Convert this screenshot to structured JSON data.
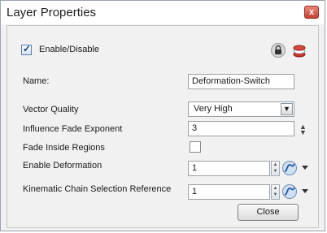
{
  "window": {
    "title": "Layer Properties",
    "close_glyph": "x"
  },
  "enable": {
    "label": "Enable/Disable",
    "checked": true
  },
  "icons": [
    "lock-icon",
    "layer-icon",
    "function-curve-icon",
    "chevron-down-icon"
  ],
  "fields": {
    "name": {
      "label": "Name:",
      "value": "Deformation-Switch"
    },
    "vector_quality": {
      "label": "Vector Quality",
      "value": "Very High"
    },
    "influence_fade_exponent": {
      "label": "Influence Fade Exponent",
      "value": "3"
    },
    "fade_inside_regions": {
      "label": "Fade Inside Regions",
      "checked": false
    },
    "enable_deformation": {
      "label": "Enable Deformation",
      "value": "1"
    },
    "kinematic_chain": {
      "label": "Kinematic Chain Selection Reference",
      "value": "1"
    }
  },
  "buttons": {
    "close": "Close"
  },
  "colors": {
    "close_x": "#c24233",
    "accent": "#1d3f7a"
  }
}
